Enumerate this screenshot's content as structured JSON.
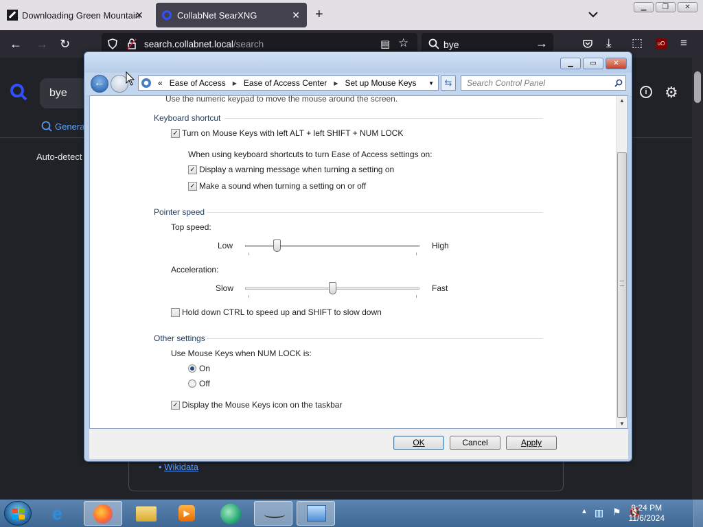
{
  "browser": {
    "tabs": [
      {
        "label": "Downloading Green Mountain",
        "icon": "download-favicon"
      },
      {
        "label": "CollabNet SearXNG",
        "icon": "searxng-favicon"
      }
    ],
    "url_host": "search.collabnet.local",
    "url_path": "/search",
    "search_value": "bye"
  },
  "page": {
    "search_value": "bye",
    "tab_general": "Genera",
    "autodetect": "Auto-detect",
    "wikidata": "Wikidata"
  },
  "dialog": {
    "breadcrumb": [
      "«",
      "Ease of Access",
      "Ease of Access Center",
      "Set up Mouse Keys"
    ],
    "search_placeholder": "Search Control Panel",
    "intro": "Use the numeric keypad to move the mouse around the screen.",
    "keyboard_shortcut": {
      "heading": "Keyboard shortcut",
      "turn_on": "Turn on Mouse Keys with left ALT + left SHIFT + NUM LOCK",
      "when_using": "When using keyboard shortcuts to turn Ease of Access settings on:",
      "warning": "Display a warning message when turning a setting on",
      "sound": "Make a sound when turning a setting on or off"
    },
    "pointer_speed": {
      "heading": "Pointer speed",
      "top_speed": "Top speed:",
      "low": "Low",
      "high": "High",
      "top_speed_level": 0.18,
      "acceleration": "Acceleration:",
      "slow": "Slow",
      "fast": "Fast",
      "acceleration_level": 0.5,
      "ctrl_shift": "Hold down CTRL to speed up and SHIFT to slow down"
    },
    "other": {
      "heading": "Other settings",
      "numlock": "Use Mouse Keys when NUM LOCK is:",
      "on": "On",
      "off": "Off",
      "taskbar_icon": "Display the Mouse Keys icon on the taskbar"
    },
    "buttons": {
      "ok": "OK",
      "cancel": "Cancel",
      "apply": "Apply"
    }
  },
  "taskbar": {
    "time": "9:24 PM",
    "date": "11/6/2024"
  }
}
